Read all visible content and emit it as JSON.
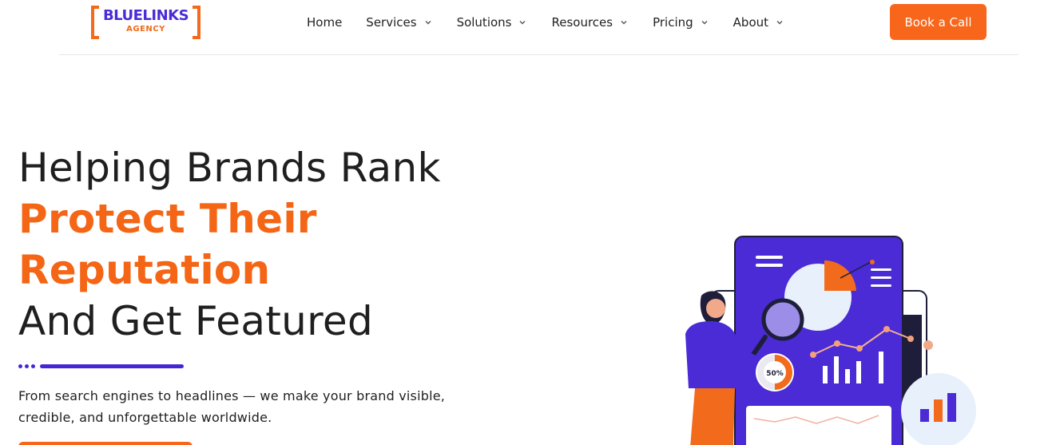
{
  "header": {
    "logo": {
      "word": "BLUELINKS",
      "sub": "AGENCY"
    },
    "nav": [
      {
        "label": "Home",
        "has_dropdown": false
      },
      {
        "label": "Services",
        "has_dropdown": true
      },
      {
        "label": "Solutions",
        "has_dropdown": true
      },
      {
        "label": "Resources",
        "has_dropdown": true
      },
      {
        "label": "Pricing",
        "has_dropdown": true
      },
      {
        "label": "About",
        "has_dropdown": true
      }
    ],
    "cta_label": "Book a Call"
  },
  "hero": {
    "line1": "Helping Brands Rank",
    "line2": "Protect Their",
    "line3": "Reputation",
    "line4": "And Get Featured",
    "description_line1": "From search engines to headlines — we make your brand visible,",
    "description_line2": "credible, and unforgettable worldwide."
  },
  "illustration": {
    "donut_label": "50%"
  },
  "colors": {
    "accent_orange": "#f7661b",
    "brand_purple": "#4a2bd6",
    "text_dark": "#1f1f1f"
  },
  "icons": [
    "chevron-down-icon",
    "menu-lines-icon",
    "magnifier-icon",
    "pie-chart-icon",
    "bar-chart-icon"
  ]
}
